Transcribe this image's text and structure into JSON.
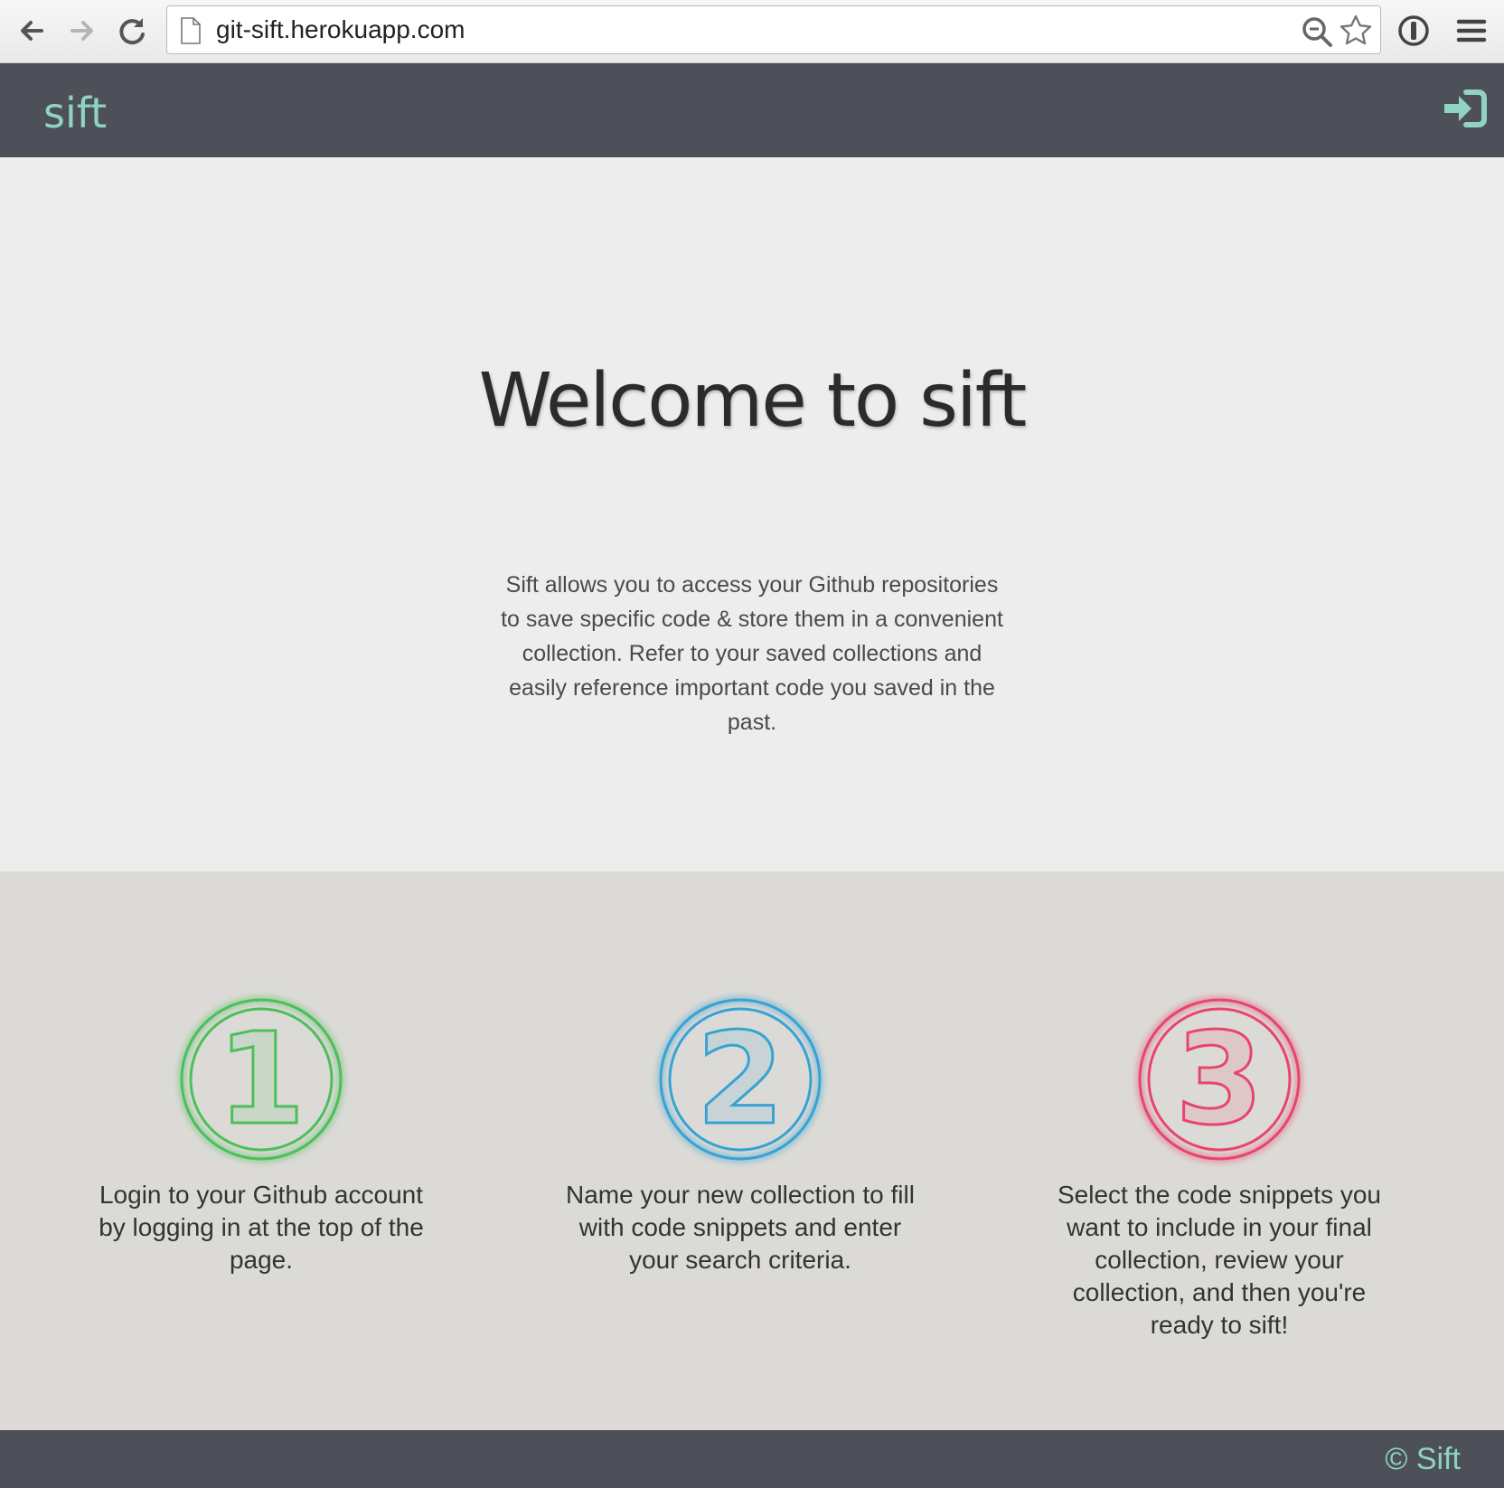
{
  "browser": {
    "url": "git-sift.herokuapp.com",
    "icons": [
      "back-arrow-icon",
      "forward-arrow-icon",
      "reload-icon",
      "page-icon",
      "zoom-icon",
      "star-icon",
      "password-manager-icon",
      "menu-icon"
    ]
  },
  "header": {
    "brand": "sift",
    "login_icon": "sign-in-icon"
  },
  "hero": {
    "title": "Welcome to sift",
    "description": "Sift allows you to access your Github repositories to save specific code & store them in a convenient collection. Refer to your saved collections and easily reference important code you saved in the past."
  },
  "steps": [
    {
      "number": "1",
      "color": "#4cbf5a",
      "text": "Login to your Github account by logging in at the top of the page."
    },
    {
      "number": "2",
      "color": "#36a3d4",
      "text": "Name your new collection to fill with code snippets and enter your search criteria."
    },
    {
      "number": "3",
      "color": "#e8456e",
      "text": "Select the code snippets you want to include in your final collection, review your collection, and then you're ready to sift!"
    }
  ],
  "footer": {
    "copyright": "© Sift"
  },
  "colors": {
    "header_bg": "#4e5059",
    "accent": "#8fd3c1",
    "hero_bg": "#ededed",
    "steps_bg": "#dcdad6"
  }
}
